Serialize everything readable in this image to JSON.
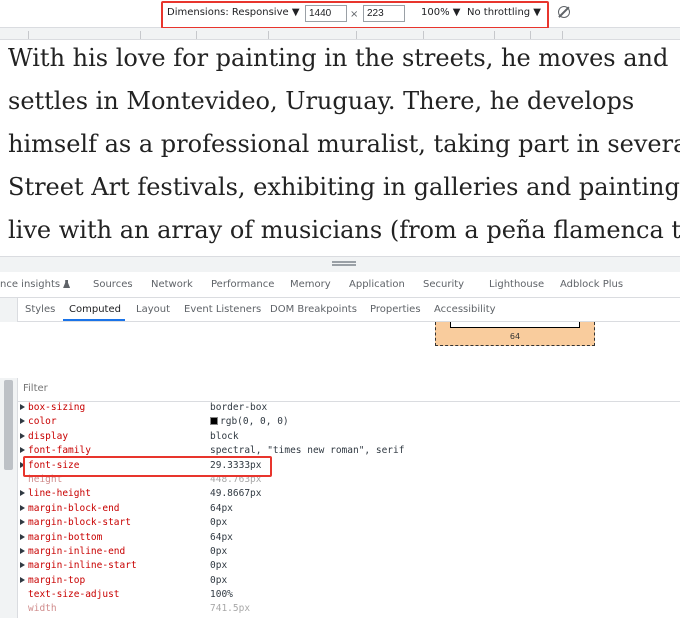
{
  "device_toolbar": {
    "dimensions_label": "Dimensions: Responsive ▼",
    "width_value": "1440",
    "times": "×",
    "height_value": "223",
    "zoom": "100% ▼",
    "throttling": "No throttling ▼",
    "rotate_icon": "rotate-icon"
  },
  "page": {
    "lines": [
      "With his love for painting in the streets, he moves and",
      "settles in Montevideo, Uruguay. There, he develops",
      "himself as a professional muralist, taking part in several",
      "Street Art festivals, exhibiting in galleries and painting",
      "live with an array of musicians (from a peña flamenca to"
    ]
  },
  "panel_tabs": [
    "nce insights",
    "Sources",
    "Network",
    "Performance",
    "Memory",
    "Application",
    "Security",
    "Lighthouse",
    "Adblock Plus"
  ],
  "sidebar_tabs": [
    "Styles",
    "Computed",
    "Layout",
    "Event Listeners",
    "DOM Breakpoints",
    "Properties",
    "Accessibility"
  ],
  "active_sidebar_tab": "Computed",
  "box_model": {
    "bottom_value": "64"
  },
  "filter": {
    "placeholder": "Filter"
  },
  "computed": [
    {
      "name": "box-sizing",
      "value": "border-box",
      "expandable": true
    },
    {
      "name": "color",
      "value": "rgb(0, 0, 0)",
      "expandable": true,
      "swatch": "#000000"
    },
    {
      "name": "display",
      "value": "block",
      "expandable": true
    },
    {
      "name": "font-family",
      "value": "spectral, \"times new roman\", serif",
      "expandable": true
    },
    {
      "name": "font-size",
      "value": "29.3333px",
      "expandable": true
    },
    {
      "name": "height",
      "value": "448.763px",
      "expandable": false,
      "inherited": true
    },
    {
      "name": "line-height",
      "value": "49.8667px",
      "expandable": true
    },
    {
      "name": "margin-block-end",
      "value": "64px",
      "expandable": true
    },
    {
      "name": "margin-block-start",
      "value": "0px",
      "expandable": true
    },
    {
      "name": "margin-bottom",
      "value": "64px",
      "expandable": true
    },
    {
      "name": "margin-inline-end",
      "value": "0px",
      "expandable": true
    },
    {
      "name": "margin-inline-start",
      "value": "0px",
      "expandable": true
    },
    {
      "name": "margin-top",
      "value": "0px",
      "expandable": true
    },
    {
      "name": "text-size-adjust",
      "value": "100%",
      "expandable": false
    },
    {
      "name": "width",
      "value": "741.5px",
      "expandable": false,
      "inherited": true
    }
  ],
  "colors": {
    "highlight": "#e8352d",
    "accent": "#1a73e8",
    "property_name": "#c80000"
  }
}
